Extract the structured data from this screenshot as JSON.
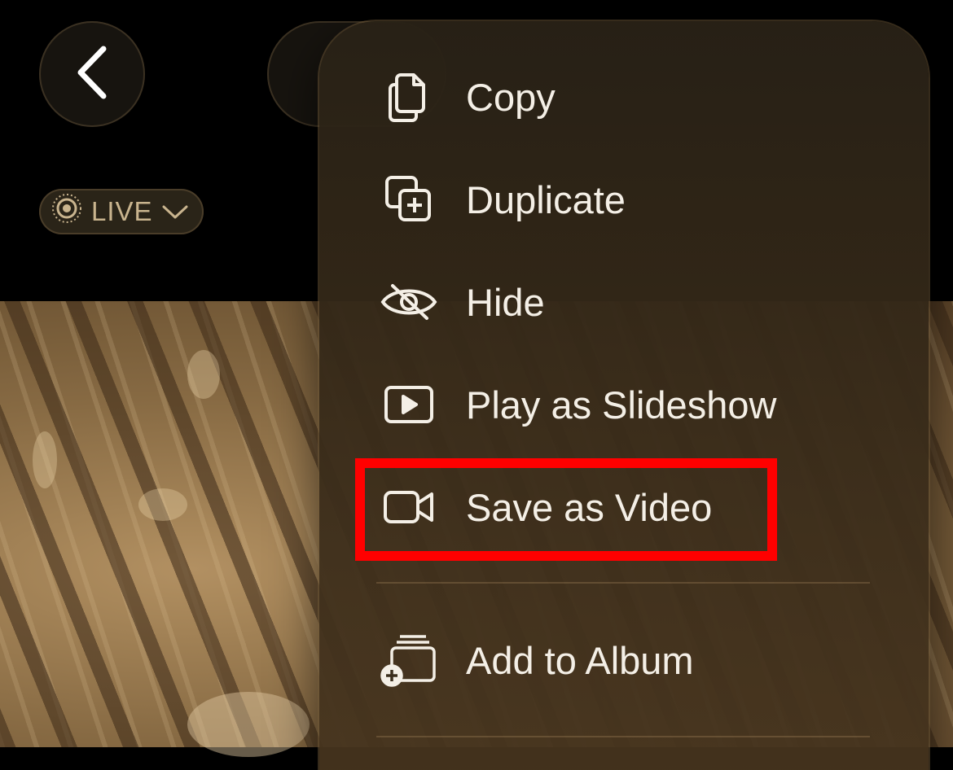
{
  "top_bar": {
    "back_icon": "chevron-left-icon",
    "live_label": "LIVE",
    "live_icon": "live-photo-icon",
    "live_chevron_icon": "chevron-down-icon"
  },
  "menu": {
    "items": [
      {
        "label": "Copy",
        "icon": "copy-icon"
      },
      {
        "label": "Duplicate",
        "icon": "duplicate-icon"
      },
      {
        "label": "Hide",
        "icon": "eye-slash-icon"
      },
      {
        "label": "Play as Slideshow",
        "icon": "play-rectangle-icon"
      },
      {
        "label": "Save as Video",
        "icon": "video-camera-icon"
      },
      {
        "label": "Add to Album",
        "icon": "add-to-album-icon"
      }
    ]
  },
  "annotation": {
    "highlight_color": "#ff0000",
    "highlighted_item": "Save as Video"
  },
  "colors": {
    "menu_text": "#f4efe6",
    "live_text": "#c9b48e"
  }
}
